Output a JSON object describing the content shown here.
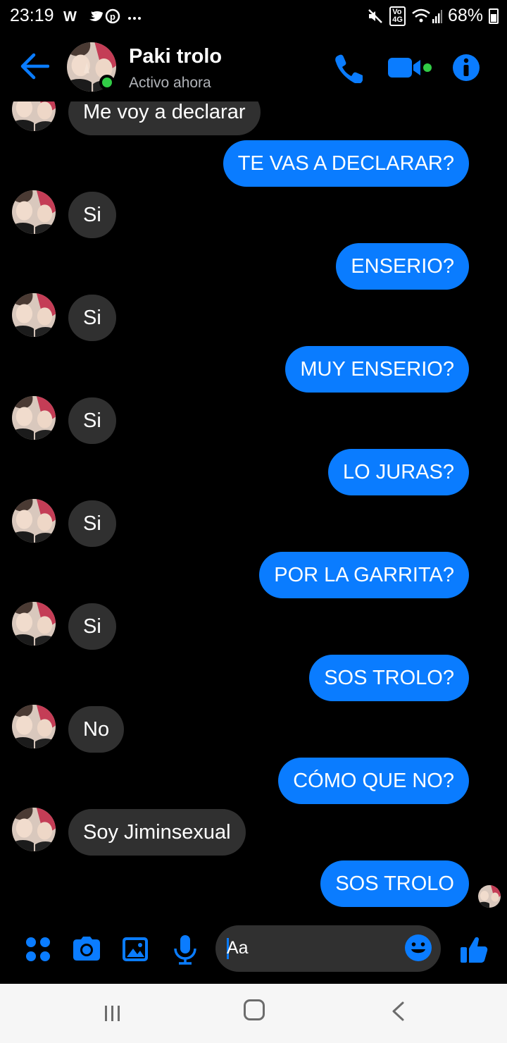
{
  "status_bar": {
    "time": "23:19",
    "left_icons": "W   ⋯",
    "volte_label": "Vo​4G",
    "battery": "68%"
  },
  "header": {
    "contact_name": "Paki trolo",
    "contact_status": "Activo ahora",
    "accent_color": "#0a7cff",
    "online_color": "#31cc46"
  },
  "messages": [
    {
      "side": "in",
      "text": "Me voy a declarar"
    },
    {
      "side": "out",
      "text": "TE VAS A DECLARAR?"
    },
    {
      "side": "in",
      "text": "Si"
    },
    {
      "side": "out",
      "text": "ENSERIO?"
    },
    {
      "side": "in",
      "text": "Si"
    },
    {
      "side": "out",
      "text": "MUY ENSERIO?"
    },
    {
      "side": "in",
      "text": "Si"
    },
    {
      "side": "out",
      "text": "LO JURAS?"
    },
    {
      "side": "in",
      "text": "Si"
    },
    {
      "side": "out",
      "text": "POR LA GARRITA?"
    },
    {
      "side": "in",
      "text": "Si"
    },
    {
      "side": "out",
      "text": "SOS TROLO?"
    },
    {
      "side": "in",
      "text": "No"
    },
    {
      "side": "out",
      "text": "CÓMO QUE NO?"
    },
    {
      "side": "in",
      "text": "Soy Jiminsexual"
    },
    {
      "side": "out",
      "text": "SOS TROLO"
    }
  ],
  "composer": {
    "placeholder": "Aa",
    "icons": [
      "menu-dots-icon",
      "camera-icon",
      "gallery-icon",
      "microphone-icon",
      "emoji-icon",
      "thumbs-up-icon"
    ]
  },
  "colors": {
    "background": "#000000",
    "incoming_bubble": "#303030",
    "outgoing_bubble": "#0a7cff"
  }
}
